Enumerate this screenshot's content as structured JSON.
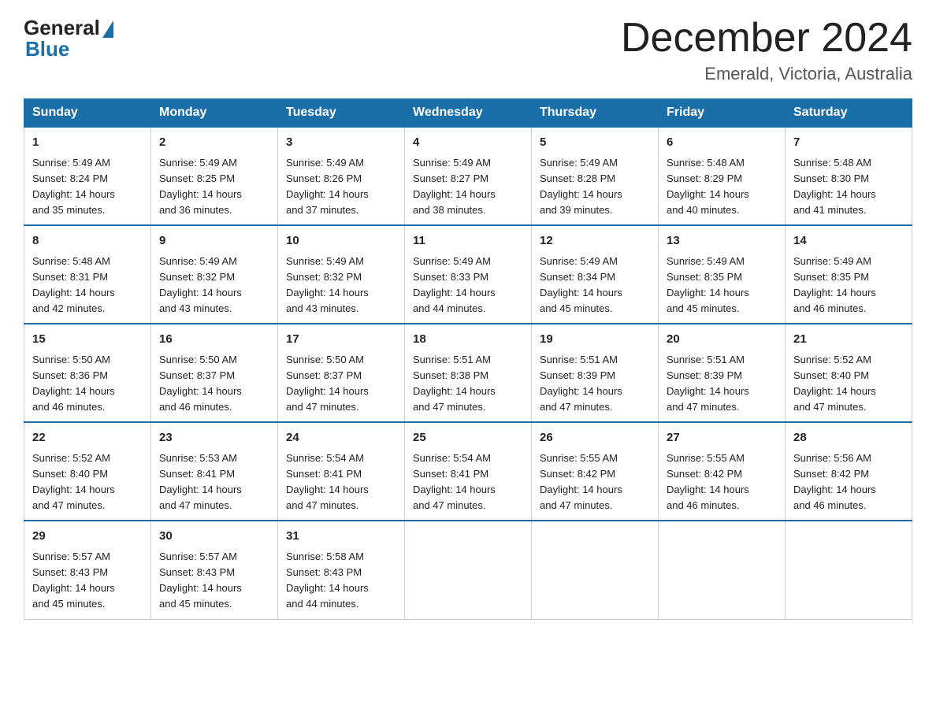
{
  "header": {
    "logo_general": "General",
    "logo_blue": "Blue",
    "month_title": "December 2024",
    "location": "Emerald, Victoria, Australia"
  },
  "days_of_week": [
    "Sunday",
    "Monday",
    "Tuesday",
    "Wednesday",
    "Thursday",
    "Friday",
    "Saturday"
  ],
  "weeks": [
    [
      {
        "day": "1",
        "sunrise": "5:49 AM",
        "sunset": "8:24 PM",
        "daylight": "14 hours and 35 minutes."
      },
      {
        "day": "2",
        "sunrise": "5:49 AM",
        "sunset": "8:25 PM",
        "daylight": "14 hours and 36 minutes."
      },
      {
        "day": "3",
        "sunrise": "5:49 AM",
        "sunset": "8:26 PM",
        "daylight": "14 hours and 37 minutes."
      },
      {
        "day": "4",
        "sunrise": "5:49 AM",
        "sunset": "8:27 PM",
        "daylight": "14 hours and 38 minutes."
      },
      {
        "day": "5",
        "sunrise": "5:49 AM",
        "sunset": "8:28 PM",
        "daylight": "14 hours and 39 minutes."
      },
      {
        "day": "6",
        "sunrise": "5:48 AM",
        "sunset": "8:29 PM",
        "daylight": "14 hours and 40 minutes."
      },
      {
        "day": "7",
        "sunrise": "5:48 AM",
        "sunset": "8:30 PM",
        "daylight": "14 hours and 41 minutes."
      }
    ],
    [
      {
        "day": "8",
        "sunrise": "5:48 AM",
        "sunset": "8:31 PM",
        "daylight": "14 hours and 42 minutes."
      },
      {
        "day": "9",
        "sunrise": "5:49 AM",
        "sunset": "8:32 PM",
        "daylight": "14 hours and 43 minutes."
      },
      {
        "day": "10",
        "sunrise": "5:49 AM",
        "sunset": "8:32 PM",
        "daylight": "14 hours and 43 minutes."
      },
      {
        "day": "11",
        "sunrise": "5:49 AM",
        "sunset": "8:33 PM",
        "daylight": "14 hours and 44 minutes."
      },
      {
        "day": "12",
        "sunrise": "5:49 AM",
        "sunset": "8:34 PM",
        "daylight": "14 hours and 45 minutes."
      },
      {
        "day": "13",
        "sunrise": "5:49 AM",
        "sunset": "8:35 PM",
        "daylight": "14 hours and 45 minutes."
      },
      {
        "day": "14",
        "sunrise": "5:49 AM",
        "sunset": "8:35 PM",
        "daylight": "14 hours and 46 minutes."
      }
    ],
    [
      {
        "day": "15",
        "sunrise": "5:50 AM",
        "sunset": "8:36 PM",
        "daylight": "14 hours and 46 minutes."
      },
      {
        "day": "16",
        "sunrise": "5:50 AM",
        "sunset": "8:37 PM",
        "daylight": "14 hours and 46 minutes."
      },
      {
        "day": "17",
        "sunrise": "5:50 AM",
        "sunset": "8:37 PM",
        "daylight": "14 hours and 47 minutes."
      },
      {
        "day": "18",
        "sunrise": "5:51 AM",
        "sunset": "8:38 PM",
        "daylight": "14 hours and 47 minutes."
      },
      {
        "day": "19",
        "sunrise": "5:51 AM",
        "sunset": "8:39 PM",
        "daylight": "14 hours and 47 minutes."
      },
      {
        "day": "20",
        "sunrise": "5:51 AM",
        "sunset": "8:39 PM",
        "daylight": "14 hours and 47 minutes."
      },
      {
        "day": "21",
        "sunrise": "5:52 AM",
        "sunset": "8:40 PM",
        "daylight": "14 hours and 47 minutes."
      }
    ],
    [
      {
        "day": "22",
        "sunrise": "5:52 AM",
        "sunset": "8:40 PM",
        "daylight": "14 hours and 47 minutes."
      },
      {
        "day": "23",
        "sunrise": "5:53 AM",
        "sunset": "8:41 PM",
        "daylight": "14 hours and 47 minutes."
      },
      {
        "day": "24",
        "sunrise": "5:54 AM",
        "sunset": "8:41 PM",
        "daylight": "14 hours and 47 minutes."
      },
      {
        "day": "25",
        "sunrise": "5:54 AM",
        "sunset": "8:41 PM",
        "daylight": "14 hours and 47 minutes."
      },
      {
        "day": "26",
        "sunrise": "5:55 AM",
        "sunset": "8:42 PM",
        "daylight": "14 hours and 47 minutes."
      },
      {
        "day": "27",
        "sunrise": "5:55 AM",
        "sunset": "8:42 PM",
        "daylight": "14 hours and 46 minutes."
      },
      {
        "day": "28",
        "sunrise": "5:56 AM",
        "sunset": "8:42 PM",
        "daylight": "14 hours and 46 minutes."
      }
    ],
    [
      {
        "day": "29",
        "sunrise": "5:57 AM",
        "sunset": "8:43 PM",
        "daylight": "14 hours and 45 minutes."
      },
      {
        "day": "30",
        "sunrise": "5:57 AM",
        "sunset": "8:43 PM",
        "daylight": "14 hours and 45 minutes."
      },
      {
        "day": "31",
        "sunrise": "5:58 AM",
        "sunset": "8:43 PM",
        "daylight": "14 hours and 44 minutes."
      },
      null,
      null,
      null,
      null
    ]
  ],
  "labels": {
    "sunrise": "Sunrise:",
    "sunset": "Sunset:",
    "daylight": "Daylight:"
  }
}
